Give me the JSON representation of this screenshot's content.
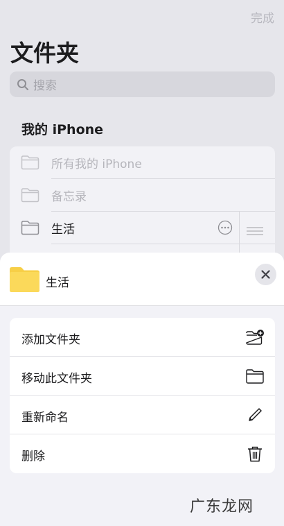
{
  "header": {
    "done_label": "完成",
    "title": "文件夹"
  },
  "search": {
    "placeholder": "搜索"
  },
  "section": {
    "title": "我的 iPhone"
  },
  "folders": [
    {
      "label": "所有我的 iPhone",
      "state": "disabled"
    },
    {
      "label": "备忘录",
      "state": "disabled"
    },
    {
      "label": "生活",
      "state": "selected"
    }
  ],
  "sheet": {
    "folder_name": "生活",
    "folder_color": "#f7cf47",
    "actions": [
      {
        "label": "添加文件夹",
        "icon": "folder-plus-icon"
      },
      {
        "label": "移动此文件夹",
        "icon": "folder-icon"
      },
      {
        "label": "重新命名",
        "icon": "pencil-icon"
      },
      {
        "label": "删除",
        "icon": "trash-icon"
      }
    ]
  },
  "watermark": {
    "text": "广东龙网"
  }
}
